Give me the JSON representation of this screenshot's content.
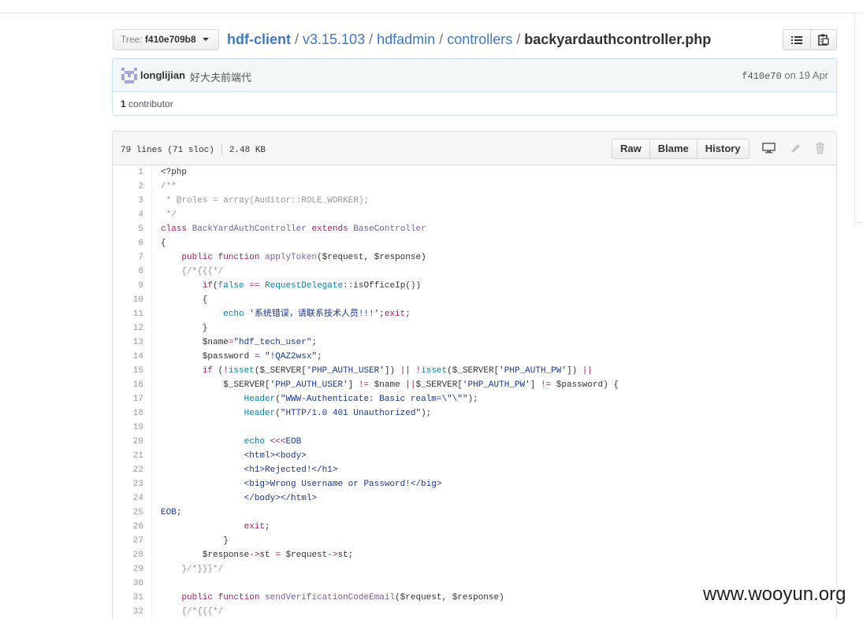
{
  "tree": {
    "label": "Tree:",
    "ref": "f410e709b8"
  },
  "breadcrumb": {
    "repo": "hdf-client",
    "parts": [
      "v3.15.103",
      "hdfadmin",
      "controllers"
    ],
    "file": "backyardauthcontroller.php"
  },
  "commit": {
    "author": "longlijian",
    "message": "好大夫前端代",
    "sha": "f410e70",
    "date_text": "on 19 Apr"
  },
  "contributors": {
    "count": "1",
    "label": "contributor"
  },
  "file": {
    "lines_info": "79 lines (71 sloc)",
    "size": "2.48 KB",
    "actions": [
      "Raw",
      "Blame",
      "History"
    ]
  },
  "icons": {
    "list": "list-icon",
    "clipboard": "clipboard-icon",
    "desktop": "desktop-icon",
    "edit": "pencil-icon",
    "delete": "trash-icon"
  },
  "code_lines": [
    {
      "n": "1",
      "t": [
        [
          "",
          "<?php"
        ]
      ]
    },
    {
      "n": "2",
      "t": [
        [
          "c",
          "/**"
        ]
      ]
    },
    {
      "n": "3",
      "t": [
        [
          "c",
          " * @roles = array(Auditor::ROLE_WORKER);"
        ]
      ]
    },
    {
      "n": "4",
      "t": [
        [
          "c",
          " */"
        ]
      ]
    },
    {
      "n": "5",
      "t": [
        [
          "k",
          "class"
        ],
        [
          "",
          " "
        ],
        [
          "f",
          "BackYardAuthController"
        ],
        [
          "",
          " "
        ],
        [
          "k",
          "extends"
        ],
        [
          "",
          " "
        ],
        [
          "f",
          "BaseController"
        ]
      ]
    },
    {
      "n": "6",
      "t": [
        [
          "",
          "{"
        ]
      ]
    },
    {
      "n": "7",
      "t": [
        [
          "",
          "    "
        ],
        [
          "k",
          "public"
        ],
        [
          "",
          " "
        ],
        [
          "k",
          "function"
        ],
        [
          "",
          " "
        ],
        [
          "f",
          "applyToken"
        ],
        [
          "",
          "($request, $response)"
        ]
      ]
    },
    {
      "n": "8",
      "t": [
        [
          "",
          "    "
        ],
        [
          "c",
          "{/*{{{*/"
        ]
      ]
    },
    {
      "n": "9",
      "t": [
        [
          "",
          "        "
        ],
        [
          "k",
          "if"
        ],
        [
          "",
          "("
        ],
        [
          "e",
          "false"
        ],
        [
          "",
          " "
        ],
        [
          "k",
          "=="
        ],
        [
          "",
          " "
        ],
        [
          "e",
          "RequestDelegate"
        ],
        [
          "k",
          "::"
        ],
        [
          "",
          "isOfficeIp())"
        ]
      ]
    },
    {
      "n": "10",
      "t": [
        [
          "",
          "        {"
        ]
      ]
    },
    {
      "n": "11",
      "t": [
        [
          "",
          "            "
        ],
        [
          "e",
          "echo"
        ],
        [
          "",
          " "
        ],
        [
          "s",
          "'系统错误，请联系技术人员!!!'"
        ],
        [
          "",
          ";"
        ],
        [
          "k",
          "exit"
        ],
        [
          "",
          ";"
        ]
      ]
    },
    {
      "n": "12",
      "t": [
        [
          "",
          "        }"
        ]
      ]
    },
    {
      "n": "13",
      "t": [
        [
          "",
          "        $name"
        ],
        [
          "k",
          "="
        ],
        [
          "s",
          "\"hdf_tech_user\""
        ],
        [
          "",
          ";"
        ]
      ]
    },
    {
      "n": "14",
      "t": [
        [
          "",
          "        $password "
        ],
        [
          "k",
          "="
        ],
        [
          "",
          " "
        ],
        [
          "s",
          "\"!QAZ2wsx\""
        ],
        [
          "",
          ";"
        ]
      ]
    },
    {
      "n": "15",
      "t": [
        [
          "",
          "        "
        ],
        [
          "k",
          "if"
        ],
        [
          "",
          " ("
        ],
        [
          "k",
          "!"
        ],
        [
          "e",
          "isset"
        ],
        [
          "",
          "($_SERVER["
        ],
        [
          "s",
          "'PHP_AUTH_USER'"
        ],
        [
          "",
          "]) "
        ],
        [
          "k",
          "||"
        ],
        [
          "",
          " "
        ],
        [
          "k",
          "!"
        ],
        [
          "e",
          "isset"
        ],
        [
          "",
          "($_SERVER["
        ],
        [
          "s",
          "'PHP_AUTH_PW'"
        ],
        [
          "",
          "]) "
        ],
        [
          "k",
          "||"
        ]
      ]
    },
    {
      "n": "16",
      "t": [
        [
          "",
          "            $_SERVER["
        ],
        [
          "s",
          "'PHP_AUTH_USER'"
        ],
        [
          "",
          "] "
        ],
        [
          "k",
          "!="
        ],
        [
          "",
          " $name "
        ],
        [
          "k",
          "||"
        ],
        [
          "",
          "$_SERVER["
        ],
        [
          "s",
          "'PHP_AUTH_PW'"
        ],
        [
          "",
          "] "
        ],
        [
          "k",
          "!="
        ],
        [
          "",
          " $password) {"
        ]
      ]
    },
    {
      "n": "17",
      "t": [
        [
          "",
          "                "
        ],
        [
          "e",
          "Header"
        ],
        [
          "",
          "("
        ],
        [
          "s",
          "\"WWW-Authenticate: Basic realm=\\\"\\\"\""
        ],
        [
          "",
          ");"
        ]
      ]
    },
    {
      "n": "18",
      "t": [
        [
          "",
          "                "
        ],
        [
          "e",
          "Header"
        ],
        [
          "",
          "("
        ],
        [
          "s",
          "\"HTTP/1.0 401 Unauthorized\""
        ],
        [
          "",
          ");"
        ]
      ]
    },
    {
      "n": "19",
      "t": [
        [
          "",
          ""
        ]
      ]
    },
    {
      "n": "20",
      "t": [
        [
          "",
          "                "
        ],
        [
          "e",
          "echo"
        ],
        [
          "",
          " "
        ],
        [
          "k",
          "<<<"
        ],
        [
          "s",
          "EOB"
        ]
      ]
    },
    {
      "n": "21",
      "t": [
        [
          "",
          "                "
        ],
        [
          "s",
          "<html><body>"
        ]
      ]
    },
    {
      "n": "22",
      "t": [
        [
          "",
          "                "
        ],
        [
          "s",
          "<h1>Rejected!</h1>"
        ]
      ]
    },
    {
      "n": "23",
      "t": [
        [
          "",
          "                "
        ],
        [
          "s",
          "<big>Wrong Username or Password!</big>"
        ]
      ]
    },
    {
      "n": "24",
      "t": [
        [
          "",
          "                "
        ],
        [
          "s",
          "</body></html>"
        ]
      ]
    },
    {
      "n": "25",
      "t": [
        [
          "s",
          "EOB"
        ],
        [
          "",
          ";"
        ]
      ]
    },
    {
      "n": "26",
      "t": [
        [
          "",
          "                "
        ],
        [
          "k",
          "exit"
        ],
        [
          "",
          ";"
        ]
      ]
    },
    {
      "n": "27",
      "t": [
        [
          "",
          "            }"
        ]
      ]
    },
    {
      "n": "28",
      "t": [
        [
          "",
          "        $response"
        ],
        [
          "k",
          "->"
        ],
        [
          "",
          "st "
        ],
        [
          "k",
          "="
        ],
        [
          "",
          " $request"
        ],
        [
          "k",
          "->"
        ],
        [
          "",
          "st;"
        ]
      ]
    },
    {
      "n": "29",
      "t": [
        [
          "",
          "    "
        ],
        [
          "c",
          "}/*}}}*/"
        ]
      ]
    },
    {
      "n": "30",
      "t": [
        [
          "",
          ""
        ]
      ]
    },
    {
      "n": "31",
      "t": [
        [
          "",
          "    "
        ],
        [
          "k",
          "public"
        ],
        [
          "",
          " "
        ],
        [
          "k",
          "function"
        ],
        [
          "",
          " "
        ],
        [
          "f",
          "sendVerificationCodeEmail"
        ],
        [
          "",
          "($request, $response)"
        ]
      ]
    },
    {
      "n": "32",
      "t": [
        [
          "",
          "    "
        ],
        [
          "c",
          "{/*{{{*/"
        ]
      ]
    }
  ],
  "watermark": "www.wooyun.org"
}
